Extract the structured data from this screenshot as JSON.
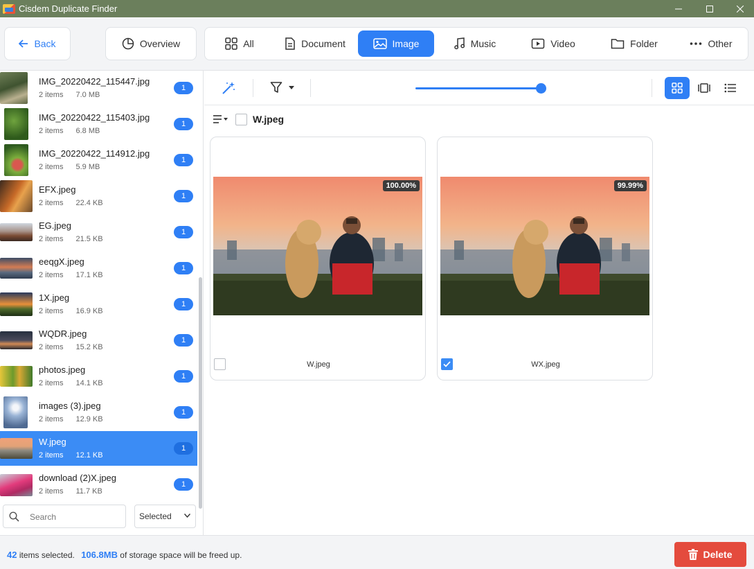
{
  "window": {
    "title": "Cisdem Duplicate Finder"
  },
  "toolbar": {
    "back_label": "Back",
    "overview_label": "Overview",
    "tabs": [
      {
        "label": "All",
        "icon": "grid-icon"
      },
      {
        "label": "Document",
        "icon": "document-icon"
      },
      {
        "label": "Image",
        "icon": "image-icon",
        "active": true
      },
      {
        "label": "Music",
        "icon": "music-note-icon"
      },
      {
        "label": "Video",
        "icon": "video-icon"
      },
      {
        "label": "Folder",
        "icon": "folder-icon"
      },
      {
        "label": "Other",
        "icon": "more-dots-icon"
      }
    ]
  },
  "sidebar": {
    "items": [
      {
        "name": "IMG_20220422_115447.jpg",
        "count": "2 items",
        "size": "7.0 MB",
        "badge": "1"
      },
      {
        "name": "IMG_20220422_115403.jpg",
        "count": "2 items",
        "size": "6.8 MB",
        "badge": "1"
      },
      {
        "name": "IMG_20220422_114912.jpg",
        "count": "2 items",
        "size": "5.9 MB",
        "badge": "1"
      },
      {
        "name": "EFX.jpeg",
        "count": "2 items",
        "size": "22.4 KB",
        "badge": "1"
      },
      {
        "name": "EG.jpeg",
        "count": "2 items",
        "size": "21.5 KB",
        "badge": "1"
      },
      {
        "name": "eeqgX.jpeg",
        "count": "2 items",
        "size": "17.1 KB",
        "badge": "1"
      },
      {
        "name": "1X.jpeg",
        "count": "2 items",
        "size": "16.9 KB",
        "badge": "1"
      },
      {
        "name": "WQDR.jpeg",
        "count": "2 items",
        "size": "15.2 KB",
        "badge": "1"
      },
      {
        "name": "photos.jpeg",
        "count": "2 items",
        "size": "14.1 KB",
        "badge": "1"
      },
      {
        "name": "images (3).jpeg",
        "count": "2 items",
        "size": "12.9 KB",
        "badge": "1"
      },
      {
        "name": "W.jpeg",
        "count": "2 items",
        "size": "12.1 KB",
        "badge": "1",
        "selected": true
      },
      {
        "name": "download (2)X.jpeg",
        "count": "2 items",
        "size": "11.7 KB",
        "badge": "1"
      }
    ],
    "search_placeholder": "Search",
    "filter_value": "Selected"
  },
  "main": {
    "group_title": "W.jpeg",
    "cards": [
      {
        "file": "W.jpeg",
        "similarity": "100.00%",
        "checked": false
      },
      {
        "file": "WX.jpeg",
        "similarity": "99.99%",
        "checked": true
      }
    ]
  },
  "footer": {
    "selected_count": "42",
    "selected_label": "items selected.",
    "space_value": "106.8MB",
    "space_label": "of storage space will be freed up.",
    "delete_label": "Delete"
  },
  "colors": {
    "accent": "#2f7ff5",
    "titlebar": "#6b7f5c",
    "delete": "#e44b3d"
  }
}
